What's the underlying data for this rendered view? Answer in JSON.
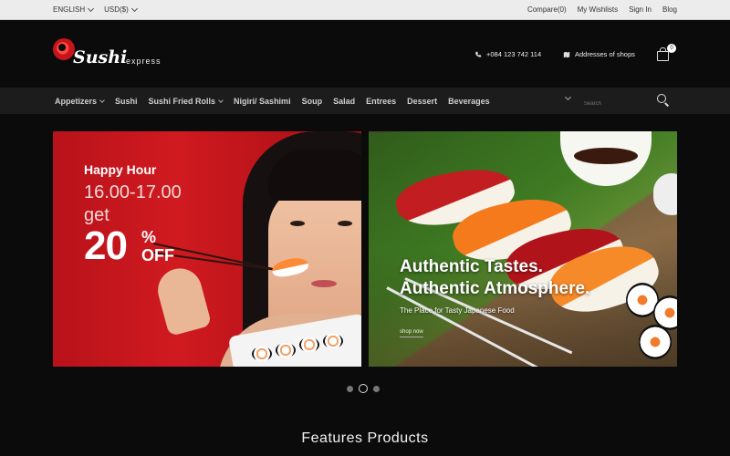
{
  "topbar": {
    "language": "ENGLISH",
    "currency": "USD($)",
    "links": [
      "Compare(0)",
      "My Wishlists",
      "Sign In",
      "Blog"
    ]
  },
  "header": {
    "logo_word": "Sushi",
    "logo_sub": "express",
    "phone": "+084 123 742 114",
    "addresses": "Addresses of shops",
    "cart_count": "0"
  },
  "nav": {
    "items": [
      {
        "label": "Appetizers",
        "has_dropdown": true
      },
      {
        "label": "Sushi",
        "has_dropdown": false
      },
      {
        "label": "Sushi Fried Rolls",
        "has_dropdown": true
      },
      {
        "label": "Nigiri/ Sashimi",
        "has_dropdown": false
      },
      {
        "label": "Soup",
        "has_dropdown": false
      },
      {
        "label": "Salad",
        "has_dropdown": false
      },
      {
        "label": "Entrees",
        "has_dropdown": false
      },
      {
        "label": "Dessert",
        "has_dropdown": false
      },
      {
        "label": "Beverages",
        "has_dropdown": false
      }
    ],
    "search_placeholder": "Search"
  },
  "banners": {
    "left": {
      "title": "Happy Hour",
      "time": "16.00-17.00",
      "get": "get",
      "discount": "20",
      "percent": "%",
      "off": "OFF"
    },
    "right": {
      "line1": "Authentic Tastes.",
      "line2": "Authentic Atmosphere.",
      "subtitle": "The Place for Tasty Japanese Food",
      "link": "shop now"
    }
  },
  "slider": {
    "dots": 3,
    "active": 2
  },
  "section": {
    "title": "Features Products"
  },
  "colors": {
    "accent_red": "#c8141c",
    "background": "#0b0b0b",
    "nav_bg": "#1c1c1c"
  }
}
